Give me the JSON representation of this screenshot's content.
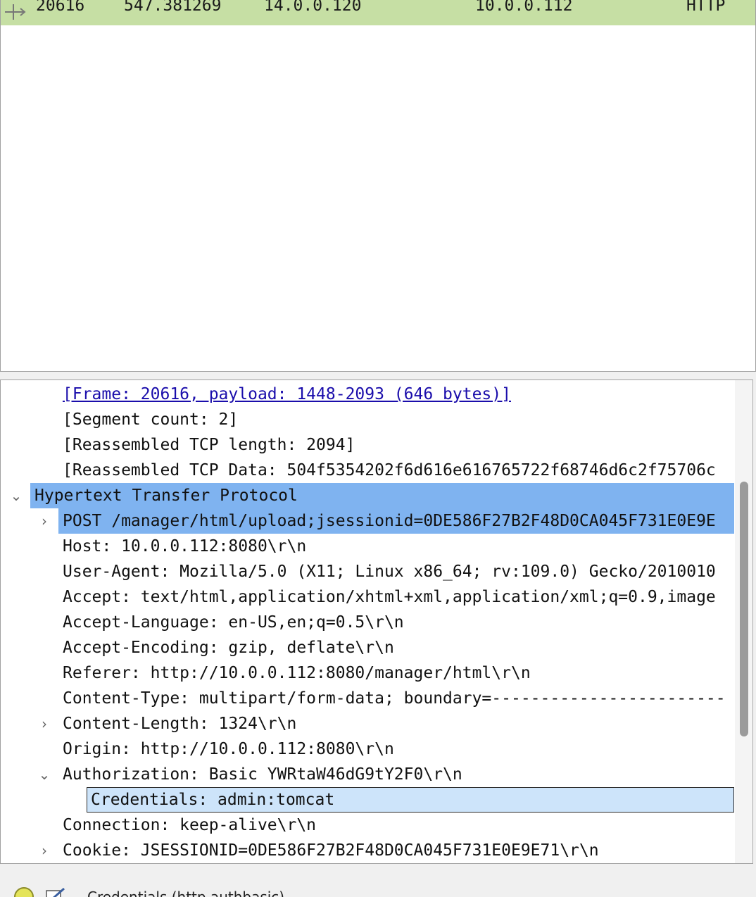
{
  "packet_list": {
    "selected_row": {
      "no": "20616",
      "time": "547.381269",
      "source": "14.0.0.120",
      "destination": "10.0.0.112",
      "protocol": "HTTP"
    },
    "row_color": "#c6dfa4"
  },
  "details": {
    "rows": [
      {
        "text": "[Frame: 20616, payload: 1448-2093 (646 bytes)]"
      },
      {
        "text": "[Segment count: 2]"
      },
      {
        "text": "[Reassembled TCP length: 2094]"
      },
      {
        "text": "[Reassembled TCP Data: 504f5354202f6d616e616765722f68746d6c2f75706c"
      },
      {
        "text": "Hypertext Transfer Protocol"
      },
      {
        "text": "POST /manager/html/upload;jsessionid=0DE586F27B2F48D0CA045F731E0E9E"
      },
      {
        "text": "Host: 10.0.0.112:8080\\r\\n"
      },
      {
        "text": "User-Agent: Mozilla/5.0 (X11; Linux x86_64; rv:109.0) Gecko/2010010"
      },
      {
        "text": "Accept: text/html,application/xhtml+xml,application/xml;q=0.9,image"
      },
      {
        "text": "Accept-Language: en-US,en;q=0.5\\r\\n"
      },
      {
        "text": "Accept-Encoding: gzip, deflate\\r\\n"
      },
      {
        "text": "Referer: http://10.0.0.112:8080/manager/html\\r\\n"
      },
      {
        "text": "Content-Type: multipart/form-data; boundary=------------------------"
      },
      {
        "text": "Content-Length: 1324\\r\\n"
      },
      {
        "text": "Origin: http://10.0.0.112:8080\\r\\n"
      },
      {
        "text": "Authorization: Basic YWRtaW46dG9tY2F0\\r\\n"
      },
      {
        "text": "Credentials: admin:tomcat"
      },
      {
        "text": "Connection: keep-alive\\r\\n"
      },
      {
        "text": "Cookie: JSESSIONID=0DE586F27B2F48D0CA045F731E0E9E71\\r\\n"
      }
    ],
    "highlight_dark": "#7fb3f0",
    "highlight_light": "#cde4fa",
    "link_color": "#1a0dab",
    "expander_icons": {
      "expanded": "chevron-down-icon",
      "collapsed": "chevron-right-icon"
    }
  },
  "statusbar": {
    "text": "Credentials (http.authbasic)",
    "icons": [
      "expert-info-icon",
      "edit-capture-comment-icon"
    ]
  }
}
